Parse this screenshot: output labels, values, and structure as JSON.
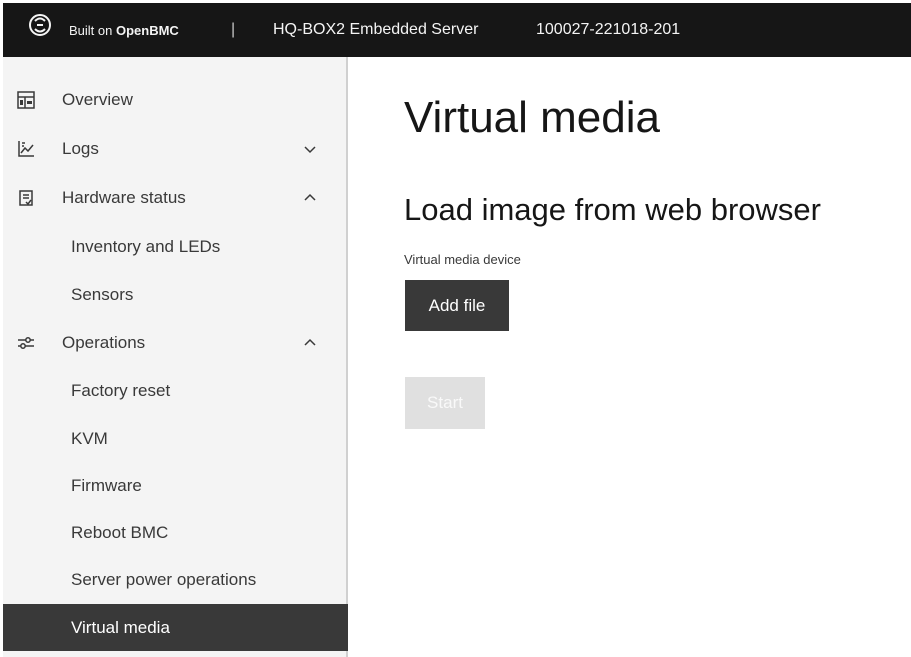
{
  "header": {
    "logo_icon": "openbmc-logo-icon",
    "built_on_prefix": "Built on ",
    "built_on_brand": "OpenBMC",
    "separator": "|",
    "server_name": "HQ-BOX2 Embedded Server",
    "server_id": "100027-221018-201"
  },
  "sidebar": {
    "items": [
      {
        "label": "Overview",
        "icon": "dashboard-icon"
      },
      {
        "label": "Logs",
        "icon": "chart-icon",
        "chevron": "chevron-down-icon"
      },
      {
        "label": "Hardware status",
        "icon": "clipboard-icon",
        "chevron": "chevron-up-icon",
        "children": [
          {
            "label": "Inventory and LEDs"
          },
          {
            "label": "Sensors"
          }
        ]
      },
      {
        "label": "Operations",
        "icon": "settings-adjust-icon",
        "chevron": "chevron-up-icon",
        "children": [
          {
            "label": "Factory reset"
          },
          {
            "label": "KVM"
          },
          {
            "label": "Firmware"
          },
          {
            "label": "Reboot BMC"
          },
          {
            "label": "Server power operations"
          },
          {
            "label": "Virtual media",
            "active": true
          }
        ]
      }
    ]
  },
  "main": {
    "page_title": "Virtual media",
    "section_title": "Load image from web browser",
    "device_label": "Virtual media device",
    "add_file_label": "Add file",
    "start_label": "Start"
  },
  "colors": {
    "header_bg": "#161616",
    "sidebar_bg": "#f4f4f4",
    "active_bg": "#393939",
    "button_primary": "#393939",
    "button_disabled": "#e0e0e0"
  }
}
